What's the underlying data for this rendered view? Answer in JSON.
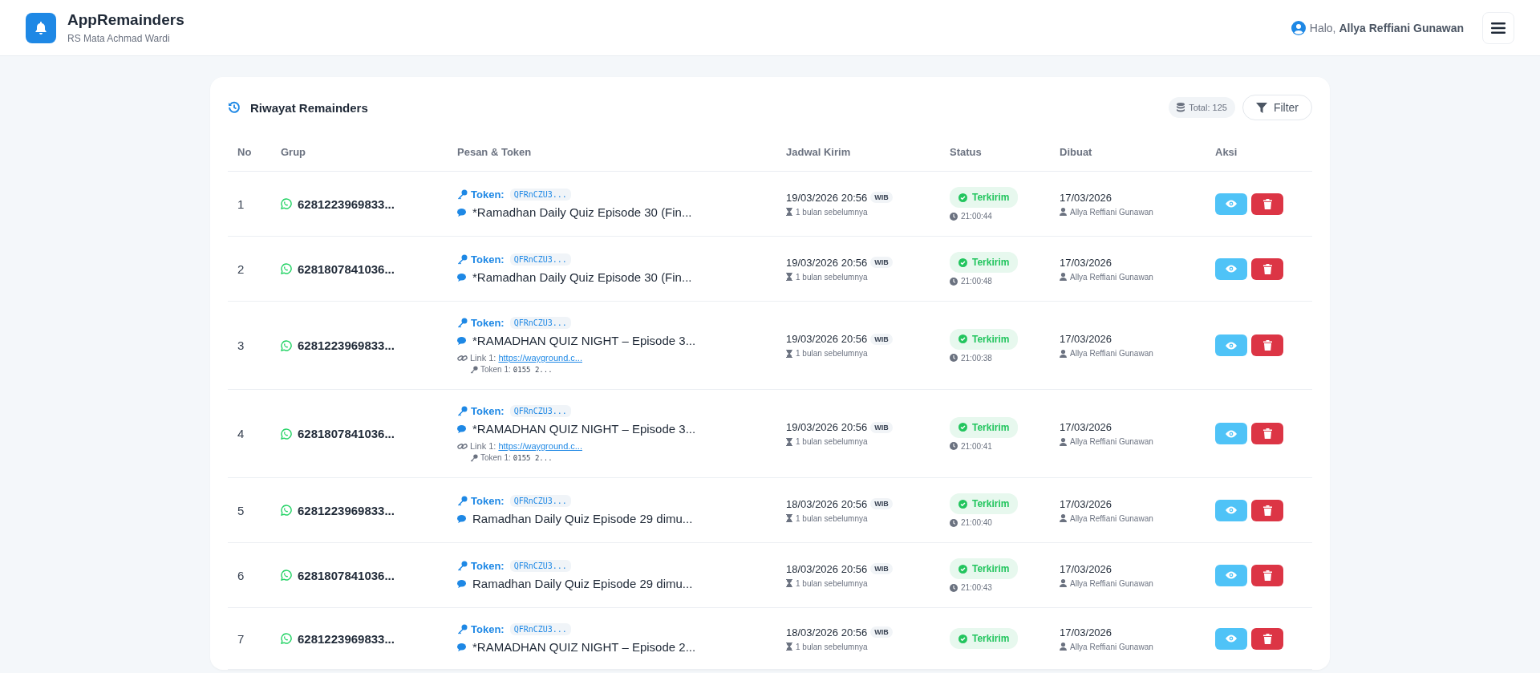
{
  "app": {
    "title": "AppRemainders",
    "subtitle": "RS Mata Achmad Wardi"
  },
  "user": {
    "greeting": "Halo,",
    "name": "Allya Reffiani Gunawan"
  },
  "panel": {
    "title": "Riwayat Remainders",
    "total": "Total: 125",
    "filter_button": "Filter"
  },
  "table": {
    "columns": [
      "No",
      "Grup",
      "Pesan & Token",
      "Jadwal Kirim",
      "Status",
      "Dibuat",
      "Aksi"
    ],
    "rows": [
      {
        "no": "1",
        "group": "6281223969833...",
        "token_label": "Token:",
        "token": "QFRnCZU3...",
        "message": "*Ramadhan Daily Quiz Episode 30 (Fin...",
        "links": [],
        "schedule": "19/03/2026 20:56",
        "tz": "WIB",
        "relative": "1 bulan sebelumnya",
        "status": {
          "kind": "sent",
          "label": "Terkirim",
          "time": "21:00:44"
        },
        "created": "17/03/2026",
        "creator": "Allya Reffiani Gunawan"
      },
      {
        "no": "2",
        "group": "6281807841036...",
        "token_label": "Token:",
        "token": "QFRnCZU3...",
        "message": "*Ramadhan Daily Quiz Episode 30 (Fin...",
        "links": [],
        "schedule": "19/03/2026 20:56",
        "tz": "WIB",
        "relative": "1 bulan sebelumnya",
        "status": {
          "kind": "sent",
          "label": "Terkirim",
          "time": "21:00:48"
        },
        "created": "17/03/2026",
        "creator": "Allya Reffiani Gunawan"
      },
      {
        "no": "3",
        "group": "6281223969833...",
        "token_label": "Token:",
        "token": "QFRnCZU3...",
        "message": "*RAMADHAN QUIZ NIGHT – Episode 3...",
        "links": [
          {
            "label": "Link 1:",
            "url": "https://wayground.c...",
            "token_label": "Token 1:",
            "token": "0155 2..."
          }
        ],
        "schedule": "19/03/2026 20:56",
        "tz": "WIB",
        "relative": "1 bulan sebelumnya",
        "status": {
          "kind": "sent",
          "label": "Terkirim",
          "time": "21:00:38"
        },
        "created": "17/03/2026",
        "creator": "Allya Reffiani Gunawan"
      },
      {
        "no": "4",
        "group": "6281807841036...",
        "token_label": "Token:",
        "token": "QFRnCZU3...",
        "message": "*RAMADHAN QUIZ NIGHT – Episode 3...",
        "links": [
          {
            "label": "Link 1:",
            "url": "https://wayground.c...",
            "token_label": "Token 1:",
            "token": "0155 2..."
          }
        ],
        "schedule": "19/03/2026 20:56",
        "tz": "WIB",
        "relative": "1 bulan sebelumnya",
        "status": {
          "kind": "sent",
          "label": "Terkirim",
          "time": "21:00:41"
        },
        "created": "17/03/2026",
        "creator": "Allya Reffiani Gunawan"
      },
      {
        "no": "5",
        "group": "6281223969833...",
        "token_label": "Token:",
        "token": "QFRnCZU3...",
        "message": "Ramadhan Daily Quiz Episode 29 dimu...",
        "links": [],
        "schedule": "18/03/2026 20:56",
        "tz": "WIB",
        "relative": "1 bulan sebelumnya",
        "status": {
          "kind": "sent",
          "label": "Terkirim",
          "time": "21:00:40"
        },
        "created": "17/03/2026",
        "creator": "Allya Reffiani Gunawan"
      },
      {
        "no": "6",
        "group": "6281807841036...",
        "token_label": "Token:",
        "token": "QFRnCZU3...",
        "message": "Ramadhan Daily Quiz Episode 29 dimu...",
        "links": [],
        "schedule": "18/03/2026 20:56",
        "tz": "WIB",
        "relative": "1 bulan sebelumnya",
        "status": {
          "kind": "sent",
          "label": "Terkirim",
          "time": "21:00:43"
        },
        "created": "17/03/2026",
        "creator": "Allya Reffiani Gunawan"
      },
      {
        "no": "7",
        "group": "6281223969833...",
        "token_label": "Token:",
        "token": "QFRnCZU3...",
        "message": "*RAMADHAN QUIZ NIGHT – Episode 2...",
        "links": [],
        "schedule": "18/03/2026 20:56",
        "tz": "WIB",
        "relative": "1 bulan sebelumnya",
        "status": {
          "kind": "sent",
          "label": "Terkirim"
        },
        "created": "17/03/2026",
        "creator": "Allya Reffiani Gunawan"
      }
    ]
  }
}
